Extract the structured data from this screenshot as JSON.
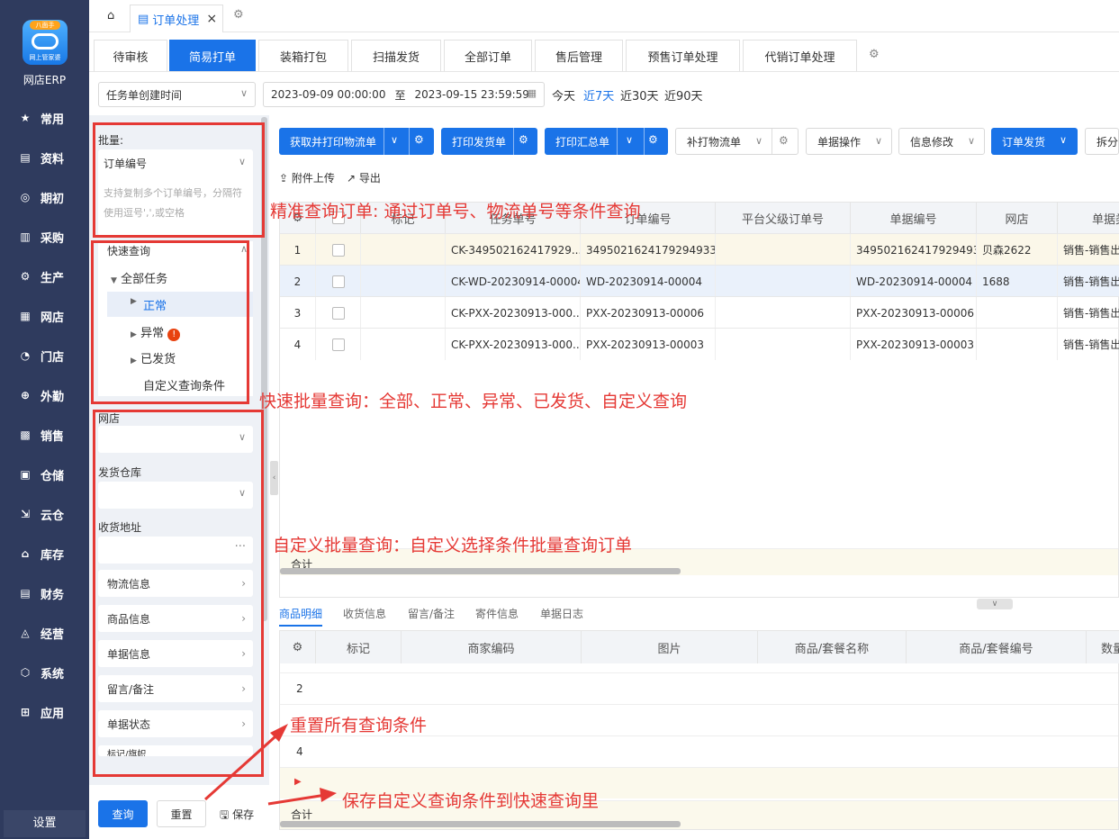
{
  "nav": {
    "app_name": "网店ERP",
    "logo_badge": "八面手",
    "logo_sub": "网上管家婆",
    "items": [
      {
        "label": "常用",
        "icon": "star-icon"
      },
      {
        "label": "资料",
        "icon": "document-icon"
      },
      {
        "label": "期初",
        "icon": "target-icon"
      },
      {
        "label": "采购",
        "icon": "purchase-icon"
      },
      {
        "label": "生产",
        "icon": "factory-icon"
      },
      {
        "label": "网店",
        "icon": "shop-icon"
      },
      {
        "label": "门店",
        "icon": "store-icon"
      },
      {
        "label": "外勤",
        "icon": "fieldwork-icon"
      },
      {
        "label": "销售",
        "icon": "sales-icon"
      },
      {
        "label": "仓储",
        "icon": "warehouse-icon"
      },
      {
        "label": "云仓",
        "icon": "cloud-warehouse-icon"
      },
      {
        "label": "库存",
        "icon": "inventory-icon"
      },
      {
        "label": "财务",
        "icon": "finance-icon"
      },
      {
        "label": "经营",
        "icon": "business-icon"
      },
      {
        "label": "系统",
        "icon": "system-icon"
      },
      {
        "label": "应用",
        "icon": "apps-icon"
      }
    ],
    "settings": "设置"
  },
  "topbar": {
    "tab_label": "订单处理"
  },
  "subtabs": [
    "待审核",
    "简易打单",
    "装箱打包",
    "扫描发货",
    "全部订单",
    "售后管理",
    "预售订单处理",
    "代销订单处理"
  ],
  "filter": {
    "date_type": "任务单创建时间",
    "date_from": "2023-09-09 00:00:00",
    "date_sep": "至",
    "date_to": "2023-09-15 23:59:59",
    "quick": [
      "今天",
      "近7天",
      "近30天",
      "近90天"
    ]
  },
  "left": {
    "batch_label": "批量:",
    "batch_type": "订单编号",
    "batch_placeholder": "支持复制多个订单编号，分隔符使用逗号',',或空格",
    "quick_query": "快速查询",
    "tree_all": "全部任务",
    "tree_normal": "正常",
    "tree_abnormal": "异常",
    "tree_shipped": "已发货",
    "tree_custom": "自定义查询条件",
    "shop_label": "网店",
    "warehouse_label": "发货仓库",
    "address_label": "收货地址",
    "sections": [
      "物流信息",
      "商品信息",
      "单据信息",
      "留言/备注",
      "单据状态"
    ],
    "cutoff": "标记/旗帜",
    "query_btn": "查询",
    "reset_btn": "重置",
    "save_btn": "保存"
  },
  "toolbar": {
    "b1": "获取并打印物流单",
    "b2": "打印发货单",
    "b3": "打印汇总单",
    "b4": "补打物流单",
    "b5": "单据操作",
    "b6": "信息修改",
    "b7": "订单发货",
    "b8": "拆分",
    "upload": "附件上传",
    "export": "导出"
  },
  "table": {
    "headers": [
      "",
      "",
      "标记",
      "任务单号",
      "订单编号",
      "平台父级订单号",
      "单据编号",
      "网店",
      "单据类"
    ],
    "rows": [
      [
        "1",
        "",
        "",
        "CK-349502162417929...",
        "3495021624179294933",
        "",
        "3495021624179294933",
        "贝森2622",
        "销售-销售出"
      ],
      [
        "2",
        "",
        "",
        "CK-WD-20230914-00004",
        "WD-20230914-00004",
        "",
        "WD-20230914-00004",
        "1688",
        "销售-销售出"
      ],
      [
        "3",
        "",
        "",
        "CK-PXX-20230913-000...",
        "PXX-20230913-00006",
        "",
        "PXX-20230913-00006",
        "",
        "销售-销售出"
      ],
      [
        "4",
        "",
        "",
        "CK-PXX-20230913-000...",
        "PXX-20230913-00003",
        "",
        "PXX-20230913-00003",
        "",
        "销售-销售出"
      ]
    ],
    "total": "合计"
  },
  "detail": {
    "tabs": [
      "商品明细",
      "收货信息",
      "留言/备注",
      "寄件信息",
      "单据日志"
    ],
    "headers": [
      "",
      "标记",
      "商家编码",
      "图片",
      "商品/套餐名称",
      "商品/套餐编号",
      "数量"
    ],
    "rows": [
      "2",
      "4"
    ],
    "total": "合计"
  },
  "annotations": {
    "a1": "精准查询订单: 通过订单号、物流单号等条件查询",
    "a2": "快速批量查询：全部、正常、异常、已发货、自定义查询",
    "a3": "自定义批量查询：自定义选择条件批量查询订单",
    "a4": "重置所有查询条件",
    "a5": "保存自定义查询条件到快速查询里"
  },
  "colors": {
    "primary": "#1a73e8",
    "nav": "#2f3b5e",
    "annotation": "#e53935"
  }
}
